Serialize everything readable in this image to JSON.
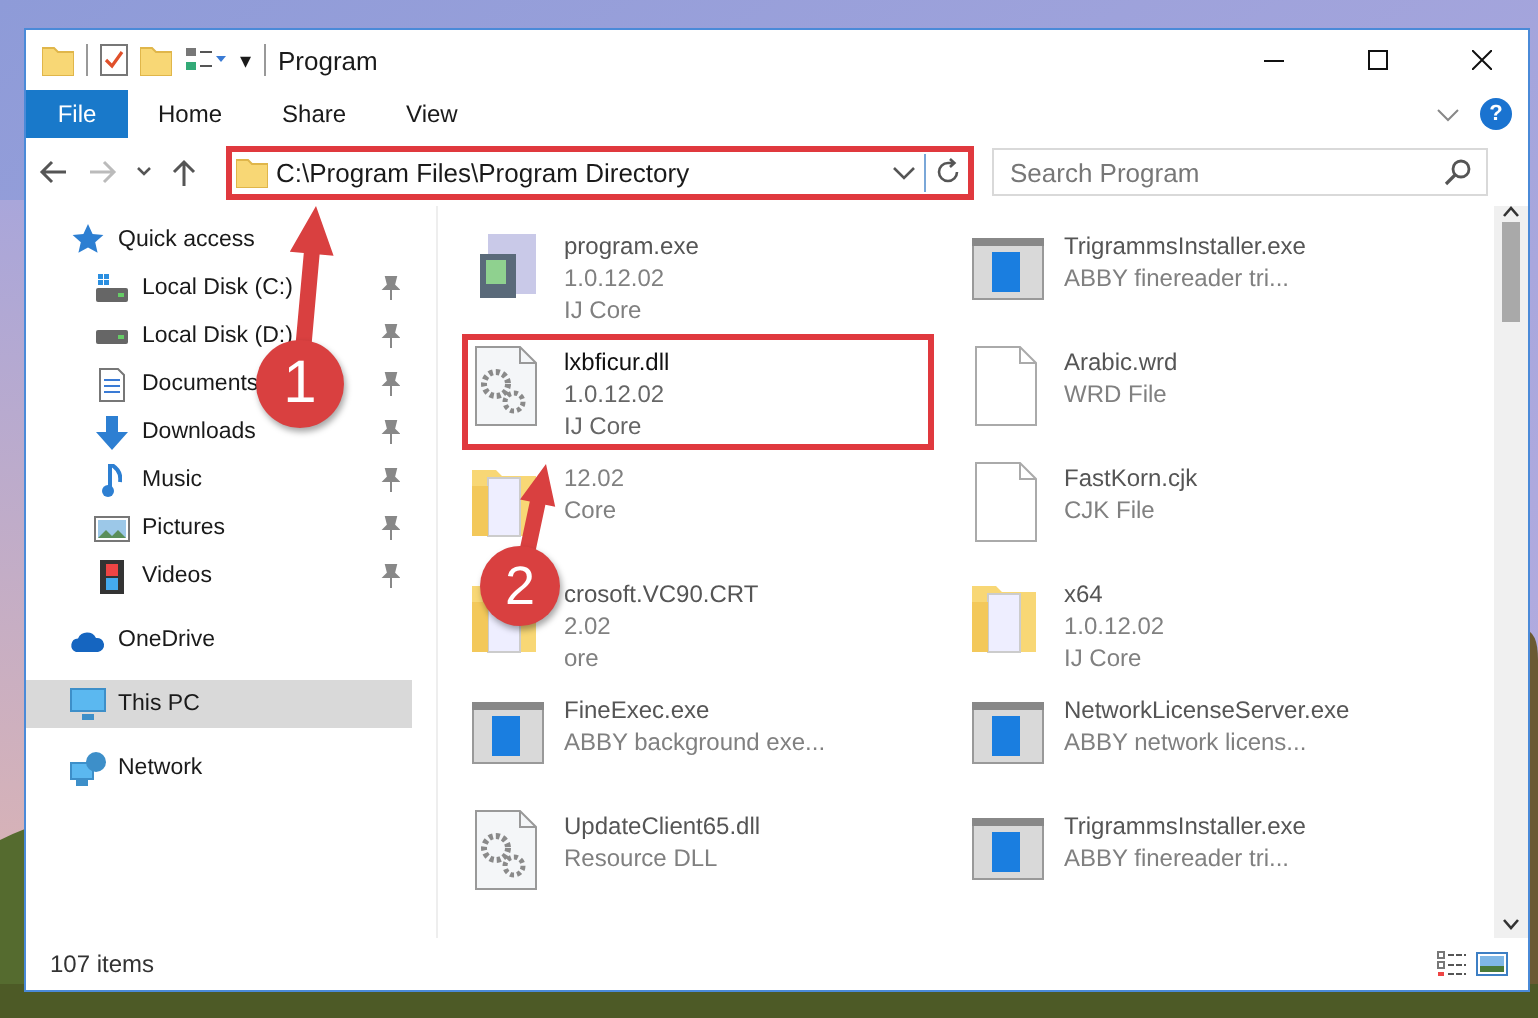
{
  "window": {
    "title": "Program"
  },
  "quick_access_toolbar": {
    "customize": "▾"
  },
  "ribbon": {
    "tabs": [
      {
        "label": "File",
        "kind": "menu"
      },
      {
        "label": "Home",
        "kind": "tab"
      },
      {
        "label": "Share",
        "kind": "tab"
      },
      {
        "label": "View",
        "kind": "tab"
      }
    ],
    "help": "?"
  },
  "address_bar": {
    "path": "C:\\Program Files\\Program Directory",
    "highlighted": true
  },
  "search": {
    "placeholder": "Search Program"
  },
  "sidebar": {
    "items": [
      {
        "label": "Quick access",
        "selected": false,
        "children": [
          {
            "label": "Local Disk (C:)",
            "pinned": true,
            "selected": false
          },
          {
            "label": "Local Disk (D:)",
            "pinned": true,
            "selected": false
          },
          {
            "label": "Documents",
            "pinned": true,
            "selected": false
          },
          {
            "label": "Downloads",
            "pinned": true,
            "selected": false
          },
          {
            "label": "Music",
            "pinned": true,
            "selected": false
          },
          {
            "label": "Pictures",
            "pinned": true,
            "selected": false
          },
          {
            "label": "Videos",
            "pinned": true,
            "selected": false
          }
        ]
      },
      {
        "label": "OneDrive",
        "selected": false
      },
      {
        "label": "This PC",
        "selected": true
      },
      {
        "label": "Network",
        "selected": false
      }
    ]
  },
  "files": [
    {
      "name": "program.exe",
      "lines": [
        "1.0.12.02",
        "IJ Core"
      ],
      "kind": "app",
      "focused": false
    },
    {
      "name": "TrigrammsInstaller.exe",
      "lines": [
        "ABBY finereader tri..."
      ],
      "kind": "window",
      "focused": false
    },
    {
      "name": "lxbficur.dll",
      "lines": [
        "1.0.12.02",
        "IJ Core"
      ],
      "kind": "gears",
      "focused": true
    },
    {
      "name": "Arabic.wrd",
      "lines": [
        "WRD File"
      ],
      "kind": "file",
      "focused": false
    },
    {
      "lines": [
        "12.02",
        "Core"
      ],
      "kind": "folder",
      "focused": false
    },
    {
      "name": "FastKorn.cjk",
      "lines": [
        "CJK File"
      ],
      "kind": "file",
      "focused": false
    },
    {
      "name": "crosoft.VC90.CRT",
      "lines": [
        "2.02",
        "ore"
      ],
      "kind": "folder",
      "focused": false
    },
    {
      "name": "x64",
      "lines": [
        "1.0.12.02",
        "IJ Core"
      ],
      "kind": "folder",
      "focused": false
    },
    {
      "name": "FineExec.exe",
      "lines": [
        "ABBY background exe..."
      ],
      "kind": "window",
      "focused": false
    },
    {
      "name": "NetworkLicenseServer.exe",
      "lines": [
        "ABBY network licens..."
      ],
      "kind": "window",
      "focused": false
    },
    {
      "name": "UpdateClient65.dll",
      "lines": [
        "Resource DLL"
      ],
      "kind": "gears",
      "focused": false
    },
    {
      "name": "TrigrammsInstaller.exe",
      "lines": [
        "ABBY finereader tri..."
      ],
      "kind": "window",
      "focused": false
    }
  ],
  "status_bar": {
    "item_count": "107 items"
  },
  "annotations": [
    {
      "label": "1"
    },
    {
      "label": "2"
    }
  ]
}
